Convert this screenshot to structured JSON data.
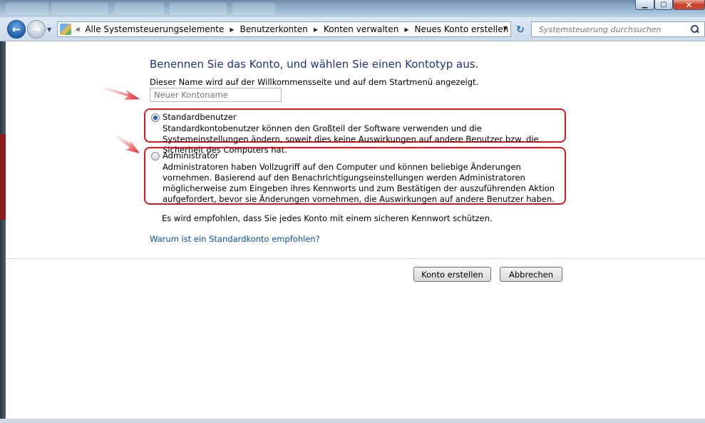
{
  "window": {
    "controls": {
      "minimize_icon": "minimize-icon",
      "maximize_icon": "maximize-icon",
      "close_icon": "close-icon"
    }
  },
  "navigation": {
    "back_icon": "back-arrow-icon",
    "forward_icon": "forward-arrow-icon",
    "address": {
      "overflow": "«",
      "breadcrumbs": [
        "Alle Systemsteuerungselemente",
        "Benutzerkonten",
        "Konten verwalten",
        "Neues Konto erstellen"
      ]
    },
    "search": {
      "placeholder": "Systemsteuerung durchsuchen"
    }
  },
  "main": {
    "heading": "Benennen Sie das Konto, und wählen Sie einen Kontotyp aus.",
    "hint": "Dieser Name wird auf der Willkommensseite und auf dem Startmenü angezeigt.",
    "name_input": {
      "placeholder": "Neuer Kontoname",
      "value": ""
    },
    "options": [
      {
        "title": "Standardbenutzer",
        "description": "Standardkontobenutzer können den Großteil der Software verwenden und die Systemeinstellungen ändern, soweit dies keine Auswirkungen auf andere Benutzer bzw. die Sicherheit des Computers hat.",
        "selected": true
      },
      {
        "title": "Administrator",
        "description": "Administratoren haben Vollzugriff auf den Computer und können beliebige Änderungen vornehmen. Basierend auf den Benachrichtigungseinstellungen werden Administratoren möglicherweise zum Eingeben ihres Kennworts und zum Bestätigen der auszuführenden Aktion aufgefordert, bevor sie Änderungen vornehmen, die Auswirkungen auf andere Benutzer haben.",
        "selected": false
      }
    ],
    "recommendation": "Es wird empfohlen, dass Sie jedes Konto mit einem sicheren Kennwort schützen.",
    "why_link": "Warum ist ein Standardkonto empfohlen?",
    "buttons": {
      "create": "Konto erstellen",
      "cancel": "Abbrechen"
    }
  },
  "colors": {
    "highlight_border": "#e0181e",
    "heading": "#1e3287",
    "link": "#0a4fb0"
  }
}
